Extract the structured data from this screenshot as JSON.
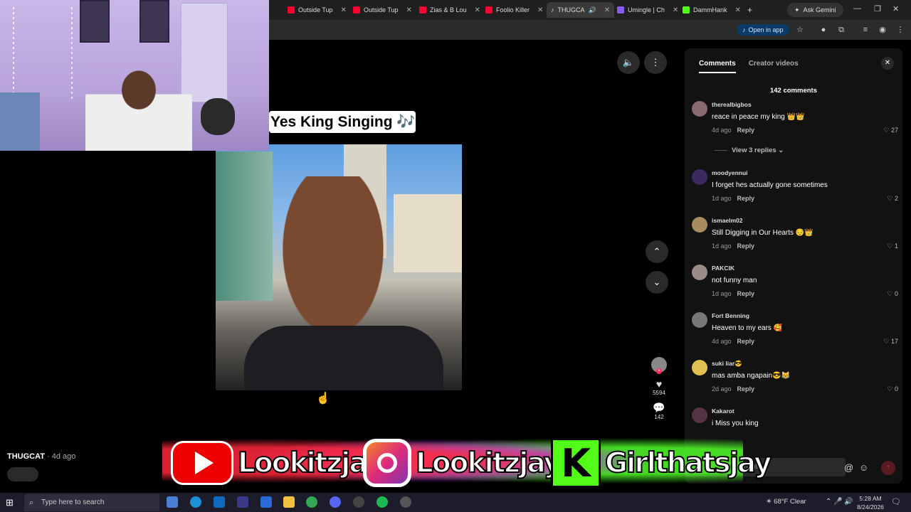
{
  "browser": {
    "tabs": [
      {
        "label": "Outside Tup",
        "icon": "youtube-icon",
        "color": "#ff0033"
      },
      {
        "label": "Outside Tup",
        "icon": "youtube-icon",
        "color": "#ff0033"
      },
      {
        "label": "Zias & B Lou",
        "icon": "youtube-icon",
        "color": "#ff0033"
      },
      {
        "label": "Foolio Killer",
        "icon": "youtube-icon",
        "color": "#ff0033"
      },
      {
        "label": "THUGCA",
        "icon": "tiktok-icon",
        "color": "#ffffff"
      },
      {
        "label": "Umingle | Ch",
        "icon": "umingle-icon",
        "color": "#8a5cf6"
      },
      {
        "label": "DammHank",
        "icon": "kick-icon",
        "color": "#53fc18"
      }
    ],
    "ask_gemini": "Ask Gemini",
    "open_in_app": "Open in app"
  },
  "video": {
    "caption": "Yes King Singing 🎶",
    "creator": "THUGCAT",
    "posted": "· 4d ago",
    "likes": "5594",
    "comments_count": "142"
  },
  "comments_panel": {
    "tabs": [
      "Comments",
      "Creator videos"
    ],
    "total": "142 comments",
    "view_replies": "View 3 replies",
    "reply_label": "Reply",
    "input_placeholder": "mment...",
    "comments": [
      {
        "user": "therealbigbos",
        "text": "reace in peace my king 👑👑",
        "ago": "4d ago",
        "likes": "27",
        "avatar_color": "#8a6a70"
      },
      {
        "user": "moodyennui",
        "text": "I forget hes actually gone sometimes",
        "ago": "1d ago",
        "likes": "2",
        "avatar_color": "#3a2a60"
      },
      {
        "user": "ismaelm02",
        "text": "Still Digging in Our Hearts 😔👑",
        "ago": "1d ago",
        "likes": "1",
        "avatar_color": "#a88c60"
      },
      {
        "user": "PAKCIK",
        "text": "not funny man",
        "ago": "1d ago",
        "likes": "0",
        "avatar_color": "#9a8a88"
      },
      {
        "user": "Fort Benning",
        "text": "Heaven to my ears 🥰",
        "ago": "4d ago",
        "likes": "17",
        "avatar_color": "#777777"
      },
      {
        "user": "suki liar😎",
        "text": "mas amba ngapain😎😹",
        "ago": "2d ago",
        "likes": "0",
        "avatar_color": "#e0c050"
      },
      {
        "user": "Kakarot",
        "text": "i Miss you king",
        "ago": "",
        "likes": "",
        "avatar_color": "#553344"
      }
    ]
  },
  "banner": {
    "youtube": "Lookitzjay",
    "instagram": "Lookitzjay_",
    "kick": "Girlthatsjay"
  },
  "taskbar": {
    "search_placeholder": "Type here to search",
    "weather": "68°F  Clear",
    "time": "5:28 AM",
    "date": "8/24/2026"
  }
}
